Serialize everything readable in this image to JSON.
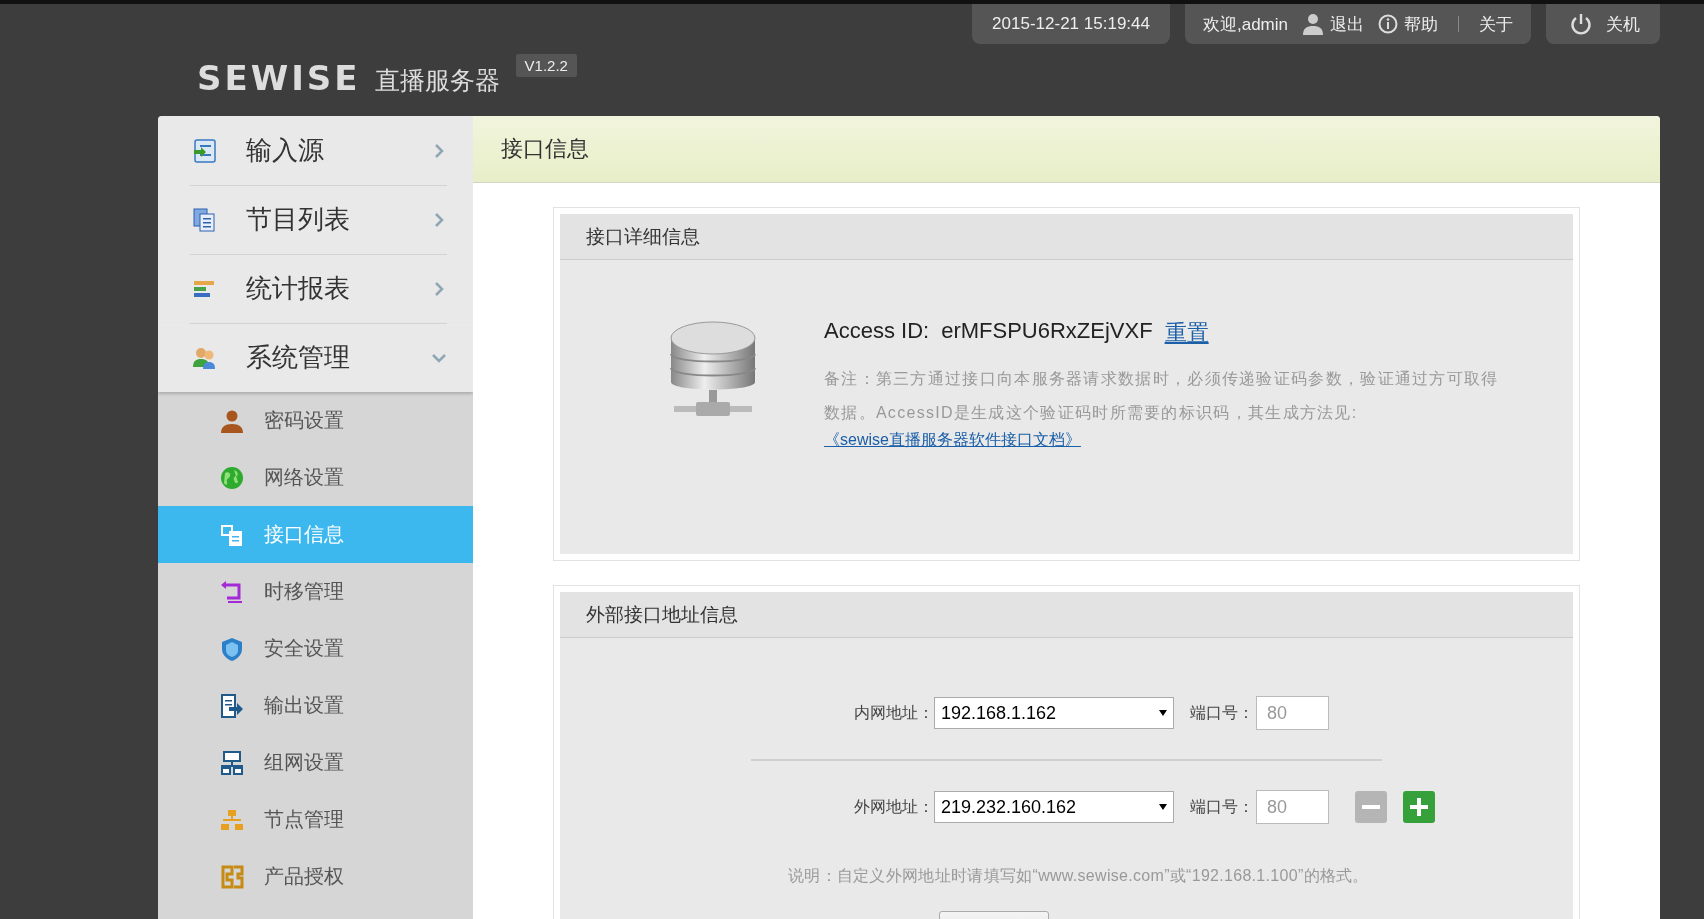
{
  "header": {
    "datetime": "2015-12-21 15:19:44",
    "welcome": "欢迎,admin",
    "logout": "退出",
    "help": "帮助",
    "about": "关于",
    "shutdown": "关机"
  },
  "logo": {
    "brand": "SEWISE",
    "product": "直播服务器",
    "version": "V1.2.2"
  },
  "sidebar": {
    "items": [
      {
        "label": "输入源",
        "expanded": false
      },
      {
        "label": "节目列表",
        "expanded": false
      },
      {
        "label": "统计报表",
        "expanded": false
      },
      {
        "label": "系统管理",
        "expanded": true,
        "children": [
          {
            "label": "密码设置",
            "selected": false
          },
          {
            "label": "网络设置",
            "selected": false
          },
          {
            "label": "接口信息",
            "selected": true
          },
          {
            "label": "时移管理",
            "selected": false
          },
          {
            "label": "安全设置",
            "selected": false
          },
          {
            "label": "输出设置",
            "selected": false
          },
          {
            "label": "组网设置",
            "selected": false
          },
          {
            "label": "节点管理",
            "selected": false
          },
          {
            "label": "产品授权",
            "selected": false
          }
        ]
      }
    ]
  },
  "page_title": "接口信息",
  "interface_panel": {
    "title": "接口详细信息",
    "access_id_label": "Access ID:",
    "access_id": "erMFSPU6RxZEjVXF",
    "reset_link": "重置",
    "note": "备注：第三方通过接口向本服务器请求数据时，必须传递验证码参数，验证通过方可取得数据。AccessID是生成这个验证码时所需要的标识码，其生成方法见:",
    "doc_link": "《sewise直播服务器软件接口文档》"
  },
  "address_panel": {
    "title": "外部接口地址信息",
    "rows": [
      {
        "kind": "internal",
        "label": "内网地址：",
        "address": "192.168.1.162",
        "port_label": "端口号：",
        "port_placeholder": "80"
      },
      {
        "kind": "external",
        "label": "外网地址：",
        "address": "219.232.160.162",
        "port_label": "端口号：",
        "port_placeholder": "80"
      }
    ],
    "note": "说明：自定义外网地址时请填写如“www.sewise.com”或“192.168.1.100”的格式。"
  }
}
